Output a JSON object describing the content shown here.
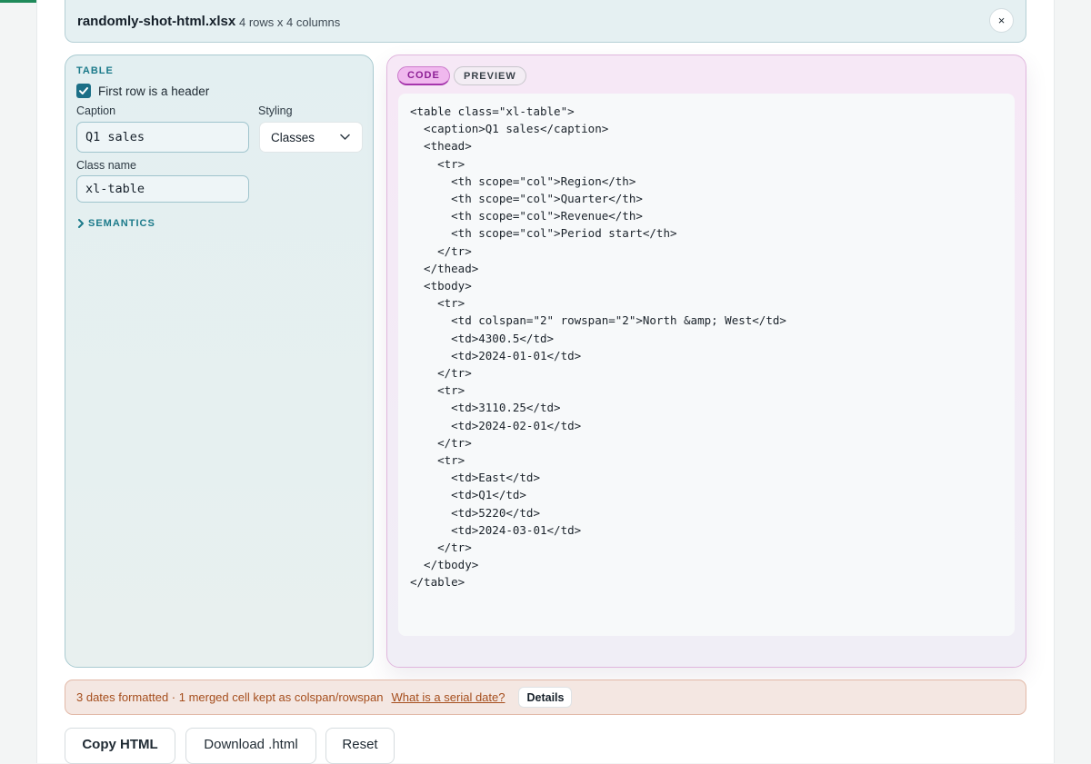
{
  "file": {
    "name": "randomly-shot-html.xlsx",
    "meta": "4 rows x 4 columns",
    "close_label": "×"
  },
  "table_settings": {
    "section_title": "TABLE",
    "header_checkbox_label": "First row is a header",
    "header_checkbox_checked": true,
    "caption_label": "Caption",
    "caption_value": "Q1 sales",
    "styling_label": "Styling",
    "styling_value": "Classes",
    "classname_label": "Class name",
    "classname_value": "xl-table",
    "semantics_label": "SEMANTICS"
  },
  "tabs": {
    "code": "CODE",
    "preview": "PREVIEW",
    "active": "code"
  },
  "code": "<table class=\"xl-table\">\n  <caption>Q1 sales</caption>\n  <thead>\n    <tr>\n      <th scope=\"col\">Region</th>\n      <th scope=\"col\">Quarter</th>\n      <th scope=\"col\">Revenue</th>\n      <th scope=\"col\">Period start</th>\n    </tr>\n  </thead>\n  <tbody>\n    <tr>\n      <td colspan=\"2\" rowspan=\"2\">North &amp; West</td>\n      <td>4300.5</td>\n      <td>2024-01-01</td>\n    </tr>\n    <tr>\n      <td>3110.25</td>\n      <td>2024-02-01</td>\n    </tr>\n    <tr>\n      <td>East</td>\n      <td>Q1</td>\n      <td>5220</td>\n      <td>2024-03-01</td>\n    </tr>\n  </tbody>\n</table>",
  "notice": {
    "text": "3 dates formatted · 1 merged cell kept as colspan/rowspan",
    "link": "What is a serial date?",
    "details_button": "Details"
  },
  "actions": {
    "copy": "Copy HTML",
    "download": "Download .html",
    "reset": "Reset"
  },
  "colors": {
    "accent_teal": "#1b7a8a",
    "accent_magenta": "#a636ac",
    "notice_text": "#a54e1d",
    "progress_green": "#1f8a5a"
  }
}
